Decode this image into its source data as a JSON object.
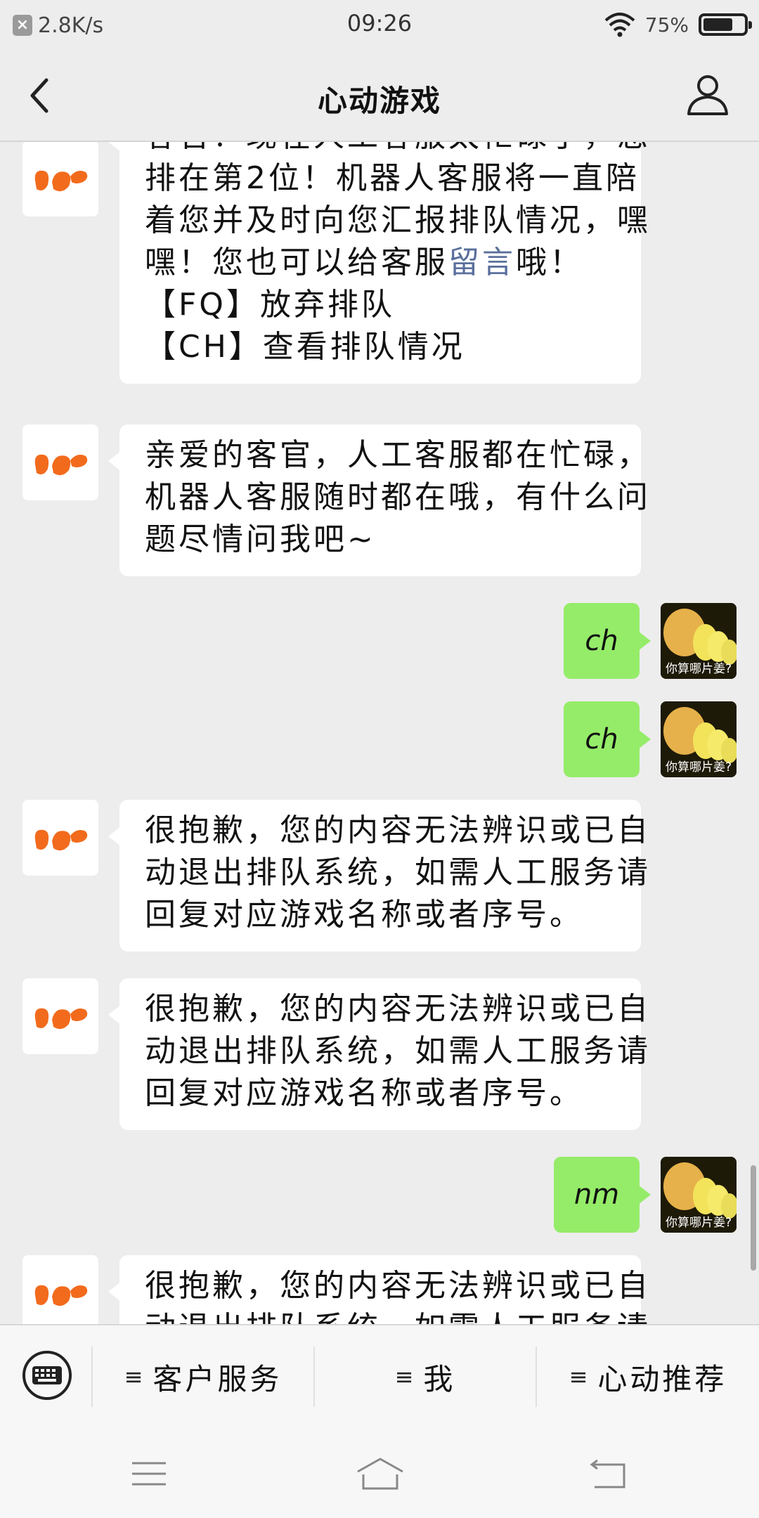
{
  "status_bar": {
    "net_speed": "2.8K/s",
    "time": "09:26",
    "battery_percent": "75%",
    "battery_level": 0.75
  },
  "header": {
    "title": "心动游戏"
  },
  "messages": [
    {
      "from": "bot",
      "lines": [
        "客官！现在人工客服太忙碌了，您",
        "排在第2位！机器人客服将一直陪",
        "着您并及时向您汇报排队情况，嘿"
      ],
      "link_prefix": "嘿！您也可以给客服",
      "link": "留言",
      "link_suffix": "哦！",
      "extra": [
        "【FQ】放弃排队",
        "【CH】查看排队情况"
      ]
    },
    {
      "from": "bot",
      "lines": [
        "亲爱的客官，人工客服都在忙碌，",
        "机器人客服随时都在哦，有什么问",
        "题尽情问我吧~"
      ]
    },
    {
      "from": "user",
      "text": "ch"
    },
    {
      "from": "user",
      "text": "ch"
    },
    {
      "from": "bot",
      "lines": [
        "很抱歉，您的内容无法辨识或已自",
        "动退出排队系统，如需人工服务请",
        "回复对应游戏名称或者序号。"
      ]
    },
    {
      "from": "bot",
      "lines": [
        "很抱歉，您的内容无法辨识或已自",
        "动退出排队系统，如需人工服务请",
        "回复对应游戏名称或者序号。"
      ]
    },
    {
      "from": "user",
      "text": "nm"
    },
    {
      "from": "bot",
      "lines": [
        "很抱歉，您的内容无法辨识或已自",
        "动退出排队系统，如需人工服务请"
      ]
    }
  ],
  "user_avatar_caption": "你算哪片姜?",
  "bottom_menu": {
    "items": [
      "客户服务",
      "我",
      "心动推荐"
    ]
  },
  "colors": {
    "background": "#ededed",
    "user_bubble": "#95ec69",
    "bot_logo": "#f26b1d",
    "link": "#5a6f9c"
  },
  "icons": [
    "x-icon",
    "wifi-icon",
    "battery-icon",
    "back-icon",
    "profile-icon",
    "bot-logo-icon",
    "keyboard-icon",
    "menu-icon",
    "home-icon",
    "return-icon"
  ]
}
